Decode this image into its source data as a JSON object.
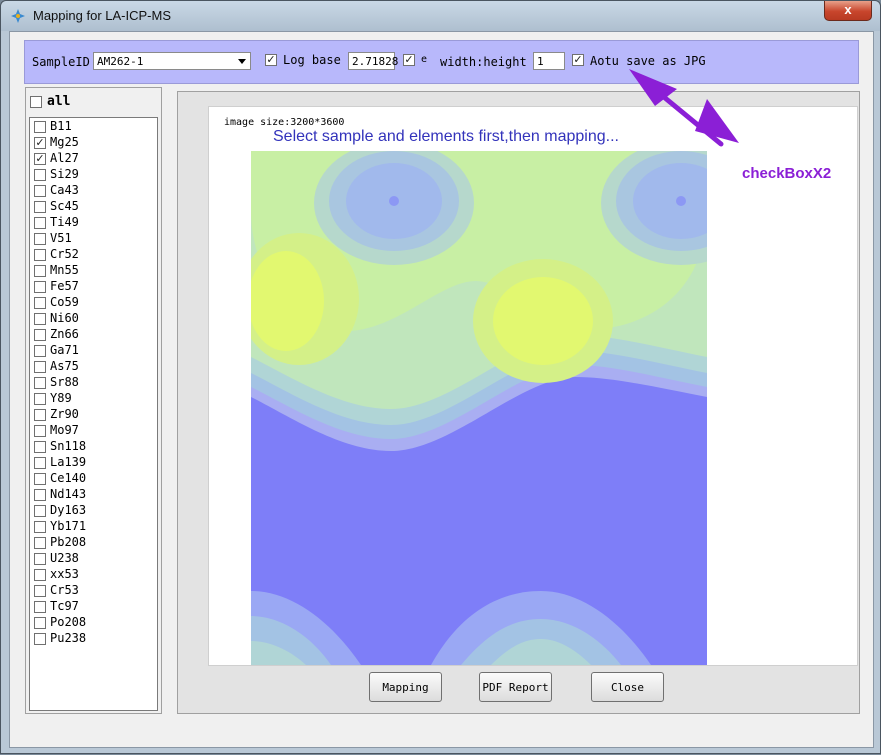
{
  "window": {
    "title": "Mapping for LA-ICP-MS",
    "close_glyph": "x"
  },
  "toolbar": {
    "sample_label": "SampleID",
    "sample_value": "AM262-1",
    "log_base_label": "Log base",
    "log_base_checked": true,
    "log_base_value": "2.71828",
    "e_label": "e",
    "e_checked": true,
    "wh_label": "width:height",
    "wh_value": "1",
    "autosave_label": "Aotu save as JPG",
    "autosave_checked": true
  },
  "elements": {
    "all_label": "all",
    "items": [
      {
        "label": "B11",
        "checked": false
      },
      {
        "label": "Mg25",
        "checked": true
      },
      {
        "label": "Al27",
        "checked": true
      },
      {
        "label": "Si29",
        "checked": false
      },
      {
        "label": "Ca43",
        "checked": false
      },
      {
        "label": "Sc45",
        "checked": false
      },
      {
        "label": "Ti49",
        "checked": false
      },
      {
        "label": "V51",
        "checked": false
      },
      {
        "label": "Cr52",
        "checked": false
      },
      {
        "label": "Mn55",
        "checked": false
      },
      {
        "label": "Fe57",
        "checked": false
      },
      {
        "label": "Co59",
        "checked": false
      },
      {
        "label": "Ni60",
        "checked": false
      },
      {
        "label": "Zn66",
        "checked": false
      },
      {
        "label": "Ga71",
        "checked": false
      },
      {
        "label": "As75",
        "checked": false
      },
      {
        "label": "Sr88",
        "checked": false
      },
      {
        "label": "Y89",
        "checked": false
      },
      {
        "label": "Zr90",
        "checked": false
      },
      {
        "label": "Mo97",
        "checked": false
      },
      {
        "label": "Sn118",
        "checked": false
      },
      {
        "label": "La139",
        "checked": false
      },
      {
        "label": "Ce140",
        "checked": false
      },
      {
        "label": "Nd143",
        "checked": false
      },
      {
        "label": "Dy163",
        "checked": false
      },
      {
        "label": "Yb171",
        "checked": false
      },
      {
        "label": "Pb208",
        "checked": false
      },
      {
        "label": "U238",
        "checked": false
      },
      {
        "label": "xx53",
        "checked": false
      },
      {
        "label": "Cr53",
        "checked": false
      },
      {
        "label": "Tc97",
        "checked": false
      },
      {
        "label": "Po208",
        "checked": false
      },
      {
        "label": "Pu238",
        "checked": false
      }
    ]
  },
  "canvas": {
    "image_size": "image size:3200*3600",
    "hint": "Select sample and elements first,then mapping...",
    "annotation": "checkBoxX2"
  },
  "buttons": {
    "mapping": "Mapping",
    "pdf": "PDF Report",
    "close": "Close"
  },
  "colors": {
    "toolbar_bg": "#b8b8fb",
    "annotation": "#8b1fd6",
    "hint": "#3333bb"
  },
  "icons": [
    "app-icon",
    "window-close-icon",
    "dropdown-arrow-icon",
    "checkbox-check-icon",
    "annotation-arrow-icon"
  ]
}
